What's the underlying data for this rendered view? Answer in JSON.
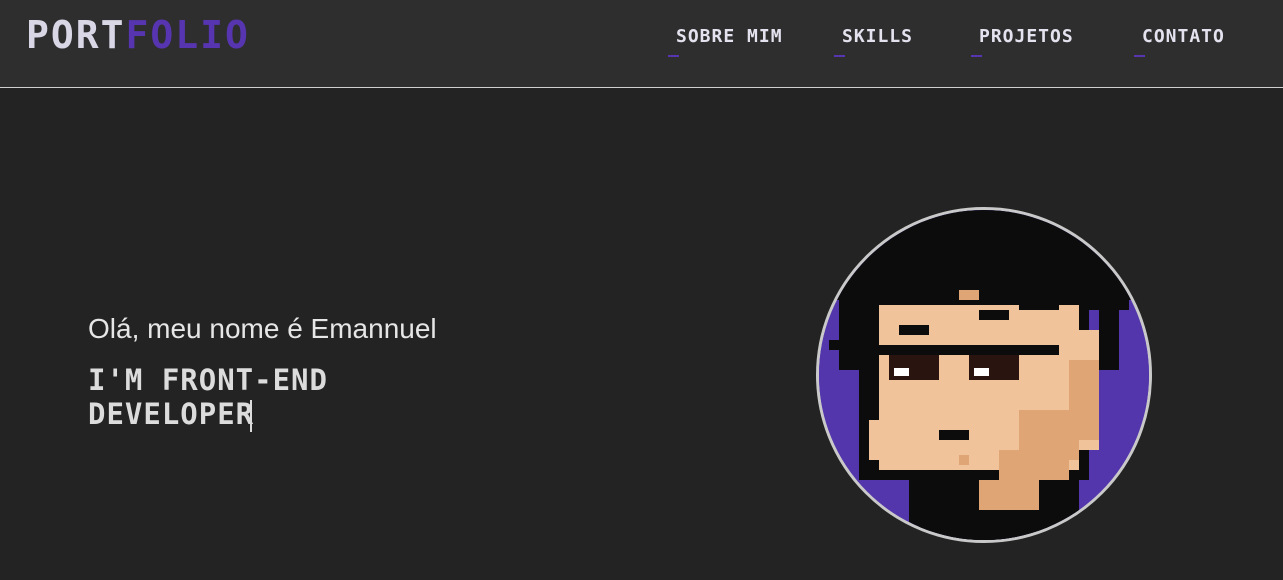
{
  "logo": {
    "part1": "PORT",
    "part2": "FOLIO"
  },
  "nav": [
    {
      "label": "SOBRE MIM"
    },
    {
      "label": "SKILLS"
    },
    {
      "label": "PROJETOS"
    },
    {
      "label": "CONTATO"
    }
  ],
  "hero": {
    "greeting": "Olá, meu nome é Emannuel",
    "role": "I'M FRONT-END DEVELOPER"
  },
  "colors": {
    "background": "#232323",
    "header": "#2e2e2e",
    "accent": "#5735b0",
    "skin": "#f0c39a"
  },
  "avatar": {
    "icon": "pixel-art-avatar"
  }
}
